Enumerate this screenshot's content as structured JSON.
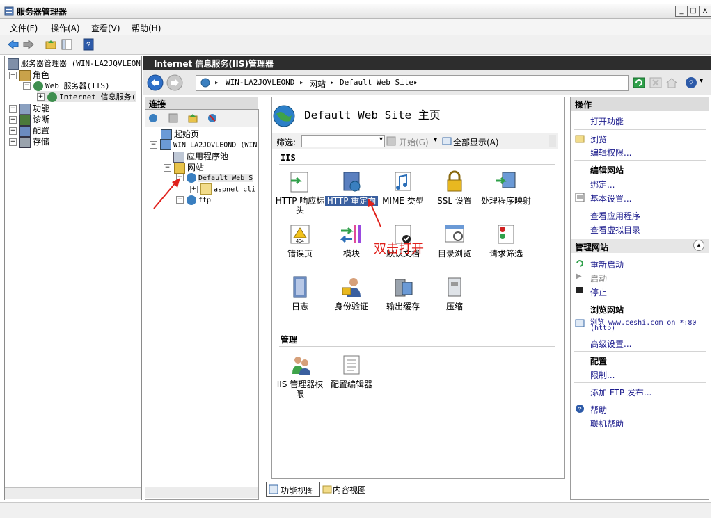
{
  "window": {
    "title": "服务器管理器",
    "minimize": "_",
    "maximize": "□",
    "close": "X"
  },
  "menu": [
    "文件(F)",
    "操作(A)",
    "查看(V)",
    "帮助(H)"
  ],
  "left_tree": {
    "root": "服务器管理器 (WIN-LA2JQVLEON",
    "roles": "角色",
    "web_server": "Web 服务器(IIS)",
    "iis_manager": "Internet 信息服务(",
    "features": "功能",
    "diagnostics": "诊断",
    "configuration": "配置",
    "storage": "存储"
  },
  "iis_header": "Internet 信息服务(IIS)管理器",
  "breadcrumb": [
    "WIN-LA2JQVLEOND",
    "网站",
    "Default Web Site"
  ],
  "connections": {
    "title": "连接",
    "start_page": "起始页",
    "server": "WIN-LA2JQVLEOND (WIN",
    "app_pools": "应用程序池",
    "sites": "网站",
    "default_site": "Default Web S",
    "aspnet": "aspnet_cli",
    "ftp": "ftp"
  },
  "center": {
    "page_title": "Default Web Site 主页",
    "filter_label": "筛选:",
    "start_label": "开始(G)",
    "show_all_label": "全部显示(A)",
    "section_iis": "IIS",
    "section_manage": "管理",
    "features_iis": [
      "HTTP 响应标头",
      "HTTP 重定向",
      "MIME 类型",
      "SSL 设置",
      "处理程序映射",
      "错误页",
      "模块",
      "默认文档",
      "目录浏览",
      "请求筛选",
      "日志",
      "身份验证",
      "输出缓存",
      "压缩"
    ],
    "features_manage": [
      "IIS 管理器权限",
      "配置编辑器"
    ],
    "annotation": "双击打开",
    "view_feature": "功能视图",
    "view_content": "内容视图"
  },
  "actions": {
    "title": "操作",
    "open_feature": "打开功能",
    "browse": "浏览",
    "edit_permissions": "编辑权限...",
    "edit_site_head": "编辑网站",
    "bindings": "绑定...",
    "basic_settings": "基本设置...",
    "view_apps": "查看应用程序",
    "view_vdirs": "查看虚拟目录",
    "manage_site_head": "管理网站",
    "restart": "重新启动",
    "start": "启动",
    "stop": "停止",
    "browse_site_head": "浏览网站",
    "browse_url": "浏览 www.ceshi.com on *:80",
    "browse_url_proto": "(http)",
    "advanced_settings": "高级设置...",
    "config_head": "配置",
    "limits": "限制...",
    "add_ftp": "添加 FTP 发布...",
    "help": "帮助",
    "online_help": "联机帮助"
  },
  "colors": {
    "annotation_red": "#e0201b",
    "selected_bg": "#3a5f9f",
    "link_blue": "#1a1a8c"
  }
}
